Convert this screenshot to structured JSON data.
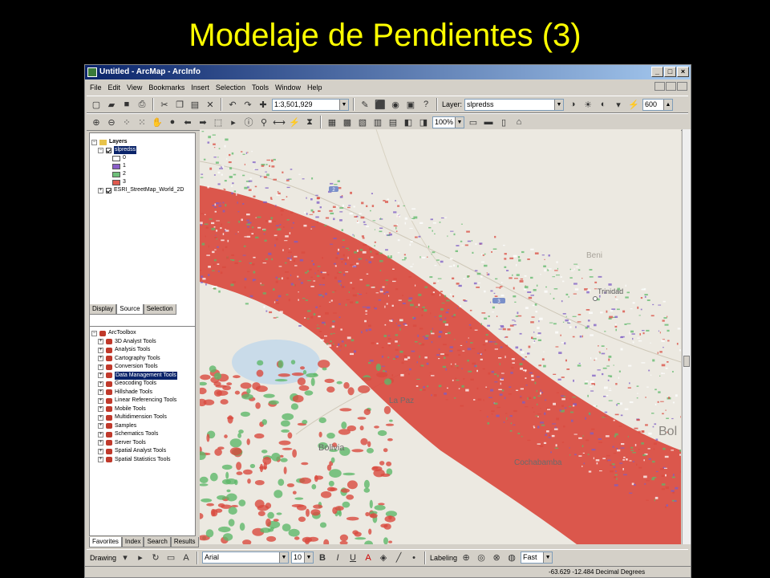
{
  "slide": {
    "title": "Modelaje de Pendientes (3)"
  },
  "window": {
    "title": "Untitled - ArcMap - ArcInfo"
  },
  "menu": [
    "File",
    "Edit",
    "View",
    "Bookmarks",
    "Insert",
    "Selection",
    "Tools",
    "Window",
    "Help"
  ],
  "toolbar": {
    "scale": "1:3,501,929",
    "layer_label": "Layer:",
    "layer_value": "slpredss",
    "zoom": "600",
    "percent": "100%"
  },
  "toc": {
    "root": "Layers",
    "layer1": "slpredss",
    "classes": [
      {
        "label": "0",
        "color": "#ffffff"
      },
      {
        "label": "1",
        "color": "#8a5ec9"
      },
      {
        "label": "2",
        "color": "#6fc07a"
      },
      {
        "label": "3",
        "color": "#e05a4f"
      }
    ],
    "layer2": "ESRI_StreetMap_World_2D",
    "tabs": [
      "Display",
      "Source",
      "Selection"
    ]
  },
  "arctoolbox": {
    "root": "ArcToolbox",
    "items": [
      "3D Analyst Tools",
      "Analysis Tools",
      "Cartography Tools",
      "Conversion Tools",
      "Data Management Tools",
      "Geocoding Tools",
      "Hillshade Tools",
      "Linear Referencing Tools",
      "Mobile Tools",
      "Multidimension Tools",
      "Samples",
      "Schematics Tools",
      "Server Tools",
      "Spatial Analyst Tools",
      "Spatial Statistics Tools"
    ],
    "selected": "Data Management Tools",
    "tabs": [
      "Favorites",
      "Index",
      "Search",
      "Results"
    ]
  },
  "map": {
    "labels": {
      "beni": "Beni",
      "trinidad": "Trinidad",
      "bol": "Bol",
      "lapaz": "La Paz",
      "bolivia": "Bolivia",
      "cochabamba": "Cochabamba"
    },
    "road_markers": [
      "3",
      "2"
    ],
    "colors": {
      "slope_high": "#d94a3f",
      "slope_mid": "#5fb86a",
      "slope_low": "#7d5cc4",
      "base": "#ece9e1"
    }
  },
  "drawing_toolbar": {
    "drawing": "Drawing",
    "font": "Arial",
    "size": "10",
    "labeling": "Labeling",
    "fast": "Fast"
  },
  "status": {
    "coords": "-63.629  -12.484 Decimal Degrees"
  }
}
